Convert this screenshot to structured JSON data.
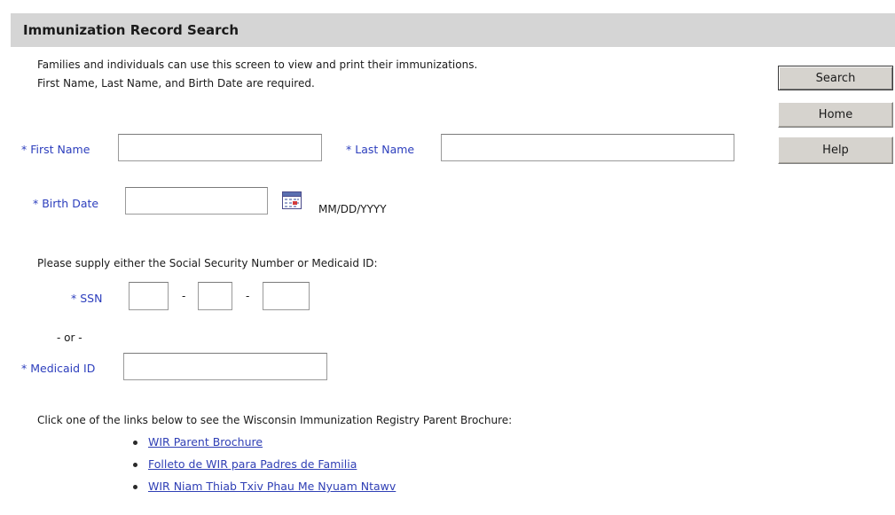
{
  "header": {
    "title": "Immunization Record Search"
  },
  "intro": {
    "line1": "Families and individuals can use this screen to view and print their immunizations.",
    "line2": "First Name, Last Name, and Birth Date are required."
  },
  "buttons": {
    "search_label": "Search",
    "home_label": "Home",
    "help_label": "Help"
  },
  "form": {
    "first_name": {
      "label": "* First Name",
      "value": ""
    },
    "last_name": {
      "label": "* Last Name",
      "value": ""
    },
    "birth_date": {
      "label": "* Birth Date",
      "value": "",
      "format_hint": "MM/DD/YYYY"
    },
    "ssn_prompt": "Please supply either the Social Security Number or Medicaid ID:",
    "ssn": {
      "label": "* SSN",
      "separator": "-",
      "part1": "",
      "part2": "",
      "part3": ""
    },
    "or_text": "- or -",
    "medicaid_id": {
      "label": "* Medicaid ID",
      "value": ""
    }
  },
  "brochure": {
    "prompt": "Click one of the links below to see the Wisconsin Immunization Registry Parent Brochure:",
    "links": [
      {
        "text": "WIR Parent Brochure"
      },
      {
        "text": "Folleto de WIR para Padres de Familia"
      },
      {
        "text": "WIR Niam Thiab Txiv Phau Me Nyuam Ntawv"
      }
    ]
  },
  "icons": {
    "calendar": "calendar-icon",
    "bullet": "bullet-icon"
  },
  "colors": {
    "header_bg": "#d5d5d5",
    "required_label": "#2c3ebd",
    "link": "#2f3fb5",
    "button_bg": "#d6d3ce"
  }
}
